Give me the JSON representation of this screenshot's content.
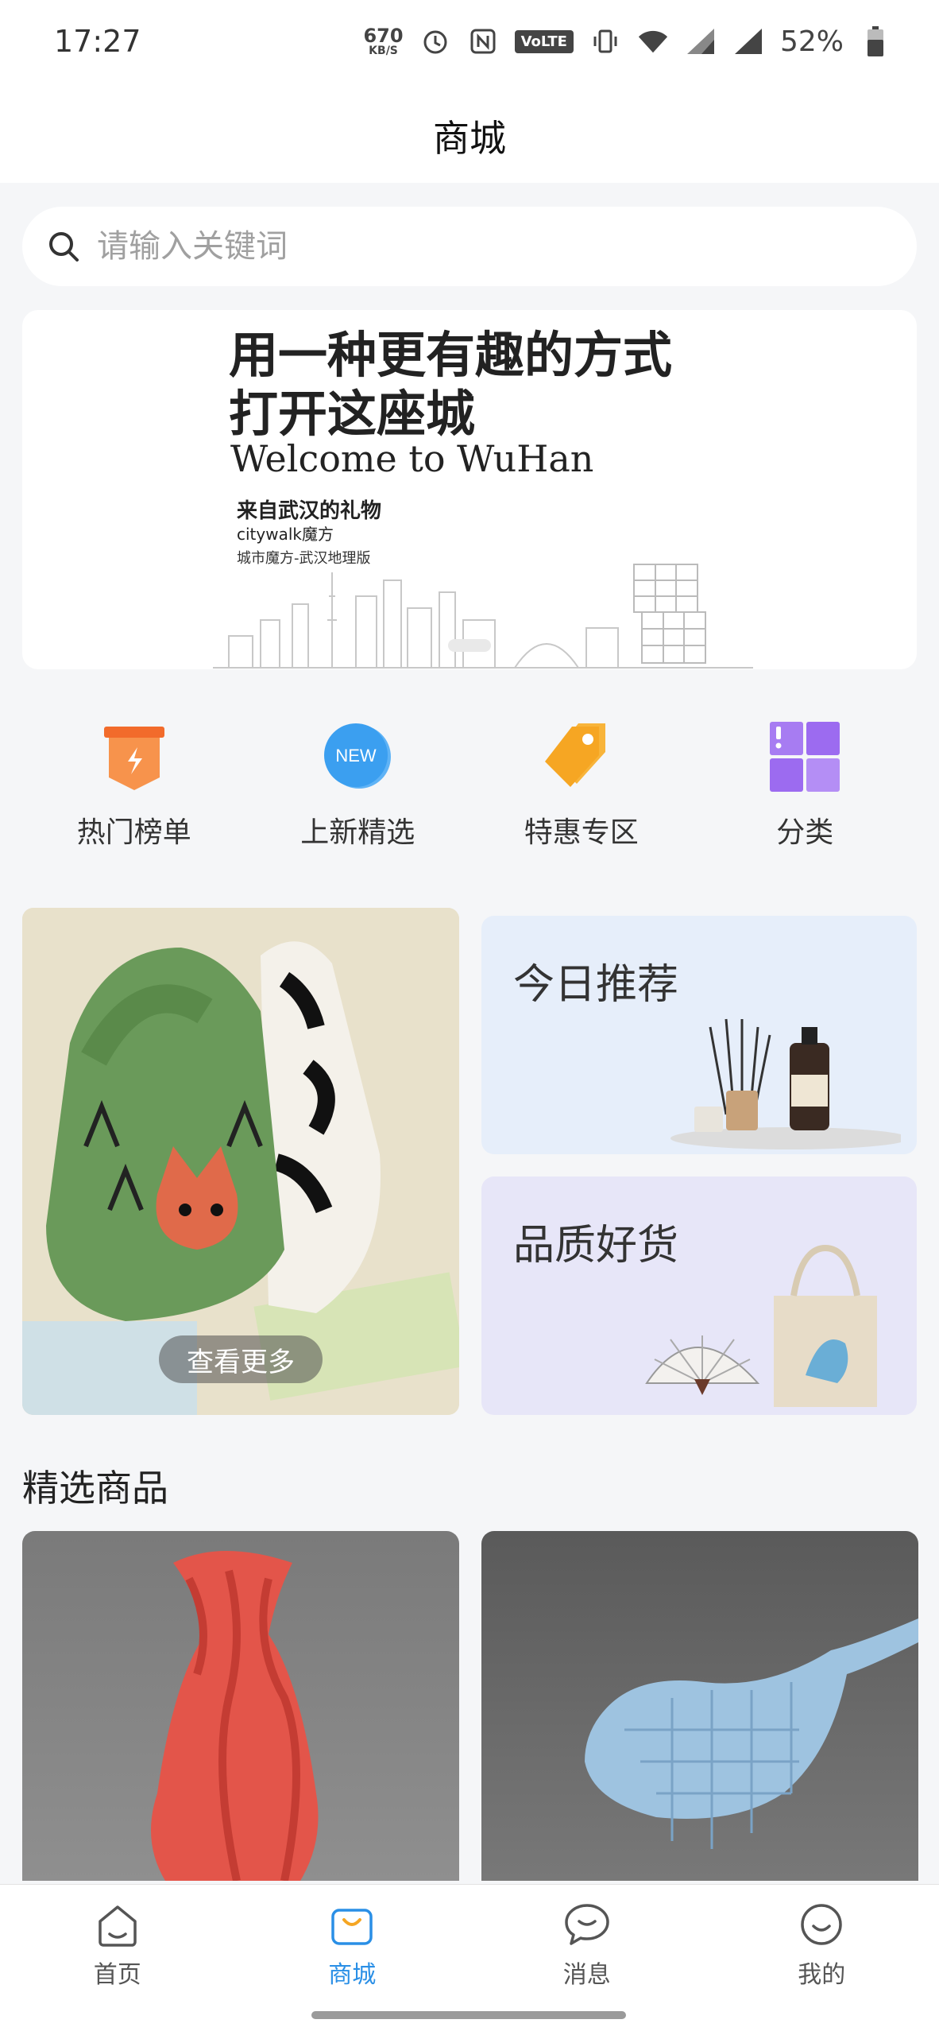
{
  "status_bar": {
    "time": "17:27",
    "net_speed_value": "670",
    "net_speed_unit": "KB/S",
    "volte": "VoLTE",
    "battery": "52%"
  },
  "header": {
    "title": "商城"
  },
  "search": {
    "placeholder": "请输入关键词"
  },
  "banner": {
    "headline_line1": "用一种更有趣的方式",
    "headline_line2": "打开这座城",
    "english": "Welcome to WuHan",
    "sub1": "来自武汉的礼物",
    "sub2": "citywalk魔方",
    "sub3": "城市魔方-武汉地理版"
  },
  "quick_entries": [
    {
      "label": "热门榜单",
      "icon": "hot-list-icon"
    },
    {
      "label": "上新精选",
      "icon": "new-icon",
      "badge": "NEW"
    },
    {
      "label": "特惠专区",
      "icon": "tag-icon"
    },
    {
      "label": "分类",
      "icon": "category-grid-icon"
    }
  ],
  "features": {
    "more_label": "查看更多",
    "today": "今日推荐",
    "quality": "品质好货"
  },
  "section": {
    "title": "精选商品"
  },
  "bottom_nav": [
    {
      "label": "首页",
      "icon": "home-icon"
    },
    {
      "label": "商城",
      "icon": "shop-bag-icon",
      "active": true
    },
    {
      "label": "消息",
      "icon": "message-icon"
    },
    {
      "label": "我的",
      "icon": "profile-icon"
    }
  ],
  "colors": {
    "accent": "#2a8fe6",
    "hot": "#f5793a",
    "new_badge": "#3b9ff0",
    "tag": "#f6a623",
    "category": "#9c6bf0"
  }
}
